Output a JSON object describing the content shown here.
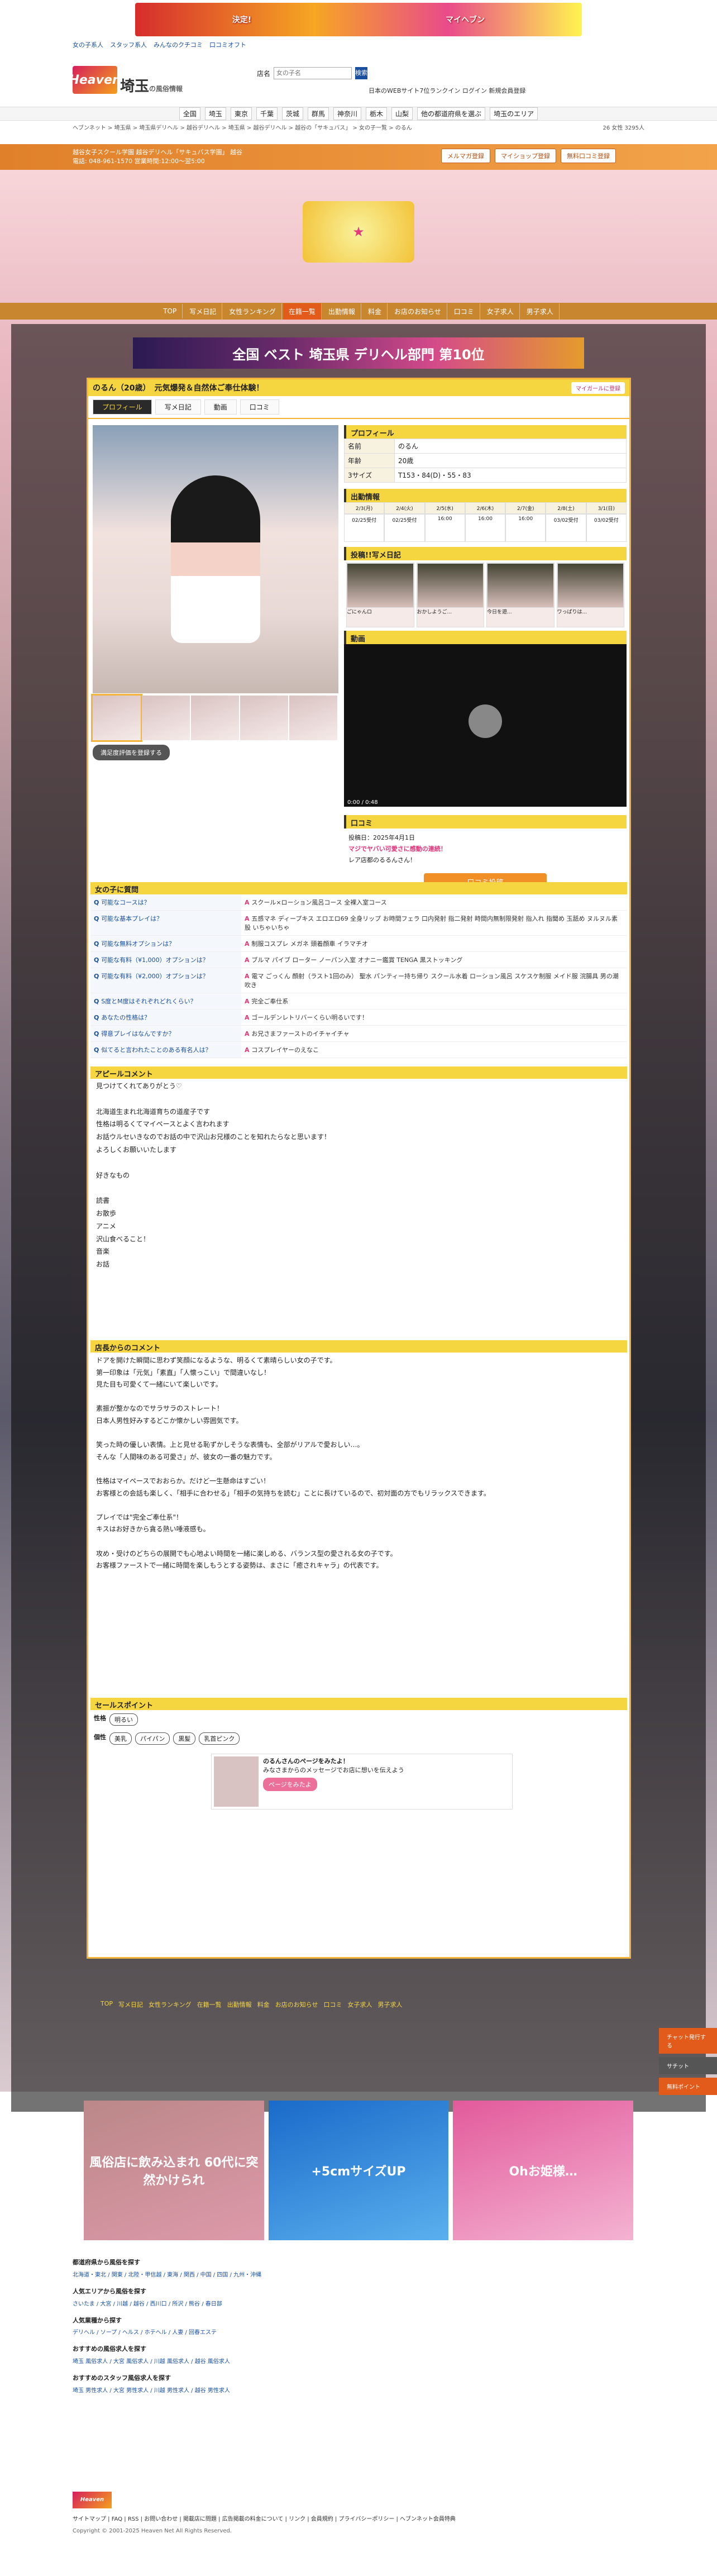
{
  "top": {
    "banner_left": "決定!",
    "banner_right": "マイヘブン",
    "links": [
      "女の子系人",
      "スタッフ系人",
      "みんなのクチコミ",
      "口コミオフト"
    ]
  },
  "header": {
    "logo": "Heaven",
    "area": "埼玉",
    "area_sub": "の風俗情報",
    "search_label": "店名",
    "search_placeholder": "女の子名",
    "search_btn": "検索",
    "right": "日本のWEBサイト7位ランクイン ログイン 新規会員登録"
  },
  "nav": [
    "全国",
    "埼玉",
    "東京",
    "千葉",
    "茨城",
    "群馬",
    "神奈川",
    "栃木",
    "山梨",
    "他の都道府県を選ぶ",
    "埼玉のエリア"
  ],
  "bread": {
    "path": "ヘブンネット > 埼玉県 > 埼玉県デリヘル > 越谷デリヘル > 埼玉県 > 越谷デリヘル > 越谷の「サキュバス」 > 女の子一覧 > のるん",
    "count": "26 女性 3295人"
  },
  "shop": {
    "info": "越谷女子スクール学園 越谷デリヘル「サキュバス学園」 越谷",
    "tel": "電話: 048-961-1570 営業時間:12:00〜翌5:00",
    "btns": [
      "メルマガ登録",
      "マイショップ登録",
      "無料口コミ登録"
    ]
  },
  "shopnav": [
    "TOP",
    "写メ日記",
    "女性ランキング",
    "在籍一覧",
    "出勤情報",
    "料金",
    "お店のお知らせ",
    "口コミ",
    "女子求人",
    "男子求人"
  ],
  "rank": {
    "text": "全国 ベスト 埼玉県 デリヘル部門 第10位"
  },
  "profile": {
    "name": "のるん（20歳）",
    "sub": "元気爆発＆自然体ご奉仕体験！",
    "mypage": "マイガールに登録",
    "tabs": [
      "プロフィール",
      "写メ日記",
      "動画",
      "口コミ"
    ],
    "fav": "満足度評価を登録する"
  },
  "prof": {
    "title": "プロフィール",
    "rows": [
      [
        "名前",
        "のるん"
      ],
      [
        "年齢",
        "20歳"
      ],
      [
        "3サイズ",
        "T153・84(D)・55・83"
      ]
    ]
  },
  "sched": {
    "title": "出勤情報",
    "days": [
      "2/3(月)",
      "2/4(火)",
      "2/5(水)",
      "2/6(木)",
      "2/7(金)",
      "2/8(土)",
      "3/1(日)"
    ],
    "times": [
      "02/25受付",
      "02/25受付",
      "16:00",
      "16:00",
      "16:00",
      "03/02受付",
      "03/02受付"
    ]
  },
  "diary": {
    "title": "投稿!!写メ日記",
    "items": [
      "ごにゃんロ",
      "おかしようご...",
      "今日を遊...",
      "ワっぱりは..."
    ]
  },
  "video": {
    "title": "動画",
    "time": "0:00 / 0:48"
  },
  "review": {
    "title": "口コミ",
    "date": "投稿日：2025年4月1日",
    "headline": "マジでヤバい可愛さに感動の連続！",
    "body": "レア店都のるるんさん！",
    "btn": "口コミ投稿"
  },
  "qa": {
    "title": "女の子に質問",
    "rows": [
      [
        "可能なコースは？",
        "スクール×ローション風呂コース 全裸入室コース"
      ],
      [
        "可能な基本プレイは？",
        "五感マネ ディープキス エロエロ69 全身リップ お時間フェラ 口内発射 指二発射 時間内無制限発射 指入れ 指聞め 玉舐め ヌルヌル素股 いちゃいちゃ"
      ],
      [
        "可能な無料オプションは？",
        "制服コスプレ メガネ 頭着顔車 イラマチオ"
      ],
      [
        "可能な有料（¥1,000）オプションは？",
        "ブルマ パイブ ローター ノーパン入室 オナニー鑑賞 TENGA 黒ストッキング"
      ],
      [
        "可能な有料（¥2,000）オプションは？",
        "電マ ごっくん 顔射（ラスト1回のみ） 聖水 パンティー持ち帰り スクール水着 ローション風呂 スケスケ制服 メイド服 浣腸具 男の潮吹き"
      ],
      [
        "S度とM度はそれぞれどれくらい？",
        "完全ご奉仕系"
      ],
      [
        "あなたの性格は？",
        "ゴールデンレトリバーくらい明るいです！"
      ],
      [
        "得意プレイはなんですか？",
        "お兄さまファーストのイチャイチャ"
      ],
      [
        "似てると言われたことのある有名人は？",
        "コスプレイヤーのえなこ"
      ]
    ]
  },
  "appeal": {
    "title": "アピールコメント",
    "body": "見つけてくれてありがとう♡\n\n北海道生まれ北海道育ちの道産子です\n性格は明るくてマイペースとよく言われます\nお話ウルセいきなのでお話の中で沢山お兄様のことを知れたらなと思います！\nよろしくお願いいたします\n\n好きなもの\n\n読書\nお散歩\nアニメ\n沢山食べること！\n音楽\nお話"
  },
  "comment": {
    "title": "店長からのコメント",
    "body": "ドアを開けた瞬間に思わず笑顔になるような、明るくて素晴らしい女の子です。\n第一印象は「元気」「素直」「人懐っこい」で間違いなし！\n見た目も可愛くて一緒にいて楽しいです。\n\n素振が整かなのでサラサラのストレート！\n日本人男性好みするどこか懐かしい雰囲気です。\n\n笑った時の優しい表情。上と見せる恥ずかしそうな表情も、全部がリアルで愛おしい…。\nそんな「人間味のある可愛さ」が、彼女の一番の魅力です。\n\n性格はマイペースでおおらか。だけど一生懸命はすごい！\nお客様との会話も楽しく、「相手に合わせる」「相手の気持ちを読む」ことに長けているので、初対面の方でもリラックスできます。\n\nプレイでは\"完全ご奉仕系\"！\nキスはお好きから貪る熱い唾液感も。\n\n攻め・受けのどちらの展開でも心地よい時間を一緒に楽しめる、バランス型の愛される女の子です。\nお客様ファーストで一緒に時間を楽しもうとする姿勢は、まさに「癒されキャラ」の代表です。"
  },
  "point": {
    "title": "セールスポイント",
    "k1": "性格",
    "v1": [
      "明るい"
    ],
    "k2": "個性",
    "v2": [
      "美乳",
      "パイパン",
      "黒髪",
      "乳首ピンク"
    ]
  },
  "share": {
    "title": "のるんさんのページをみたよ！",
    "desc": "みなさまからのメッセージでお店に想いを伝えよう",
    "btn": "ページをみたよ"
  },
  "bottomnav": [
    "TOP",
    "写メ日記",
    "女性ランキング",
    "在籍一覧",
    "出勤情報",
    "料金",
    "お店のお知らせ",
    "口コミ",
    "女子求人",
    "男子求人"
  ],
  "side": [
    "チャット発行する",
    "サチット",
    "無料ポイント"
  ],
  "ads": [
    "風俗店に飲み込まれ 60代に突然かけられ",
    "+5cmサイズUP",
    "Ohお姫様…"
  ],
  "area": {
    "h1": "都道府県から風俗を探す",
    "h2": "人気エリアから風俗を探す",
    "h3": "人気業種から探す",
    "h4": "おすすめの風俗求人を探す",
    "h5": "おすすめのスタッフ風俗求人を探す"
  },
  "footer": {
    "links": "サイトマップ | FAQ | RSS | お問い合わせ | 掲載店に問題 | 広告掲載の料金について | リンク | 会員規約 | プライバシーポリシー | ヘブンネット会員特典",
    "copy": "Copyright © 2001-2025 Heaven Net All Rights Reserved."
  }
}
